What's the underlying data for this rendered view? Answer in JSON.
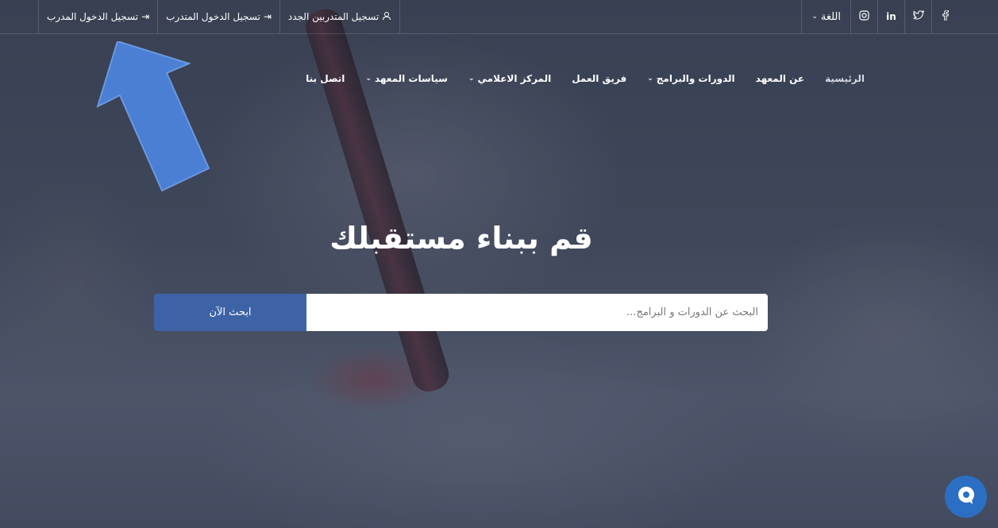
{
  "topbar": {
    "links": [
      {
        "label": "تسجيل الدخول المدرب",
        "icon": "login-icon"
      },
      {
        "label": "تسجيل الدخول المتدرب",
        "icon": "login-icon"
      },
      {
        "label": "تسجيل المتدربين الجدد",
        "icon": "user-icon"
      }
    ],
    "language_label": "اللغة",
    "social": [
      "instagram-icon",
      "linkedin-icon",
      "twitter-icon",
      "facebook-icon"
    ]
  },
  "nav": {
    "items": [
      {
        "label": "الرئيسية",
        "active": true,
        "has_dropdown": false
      },
      {
        "label": "عن المعهد",
        "has_dropdown": false
      },
      {
        "label": "الدورات والبرامج",
        "has_dropdown": true
      },
      {
        "label": "فريق العمل",
        "has_dropdown": false
      },
      {
        "label": "المركز الاعلامي",
        "has_dropdown": true
      },
      {
        "label": "سياسات المعهد",
        "has_dropdown": true
      },
      {
        "label": "اتصل بنا",
        "has_dropdown": false
      }
    ]
  },
  "hero": {
    "title": "قم ببناء مستقبلك",
    "search_placeholder": "البحث عن الدورات و البرامج...",
    "search_button": "ابحث الآن"
  },
  "colors": {
    "accent": "#3d63a6",
    "chat": "#2b6fc4",
    "annotation_arrow": "#4a7fd4"
  }
}
